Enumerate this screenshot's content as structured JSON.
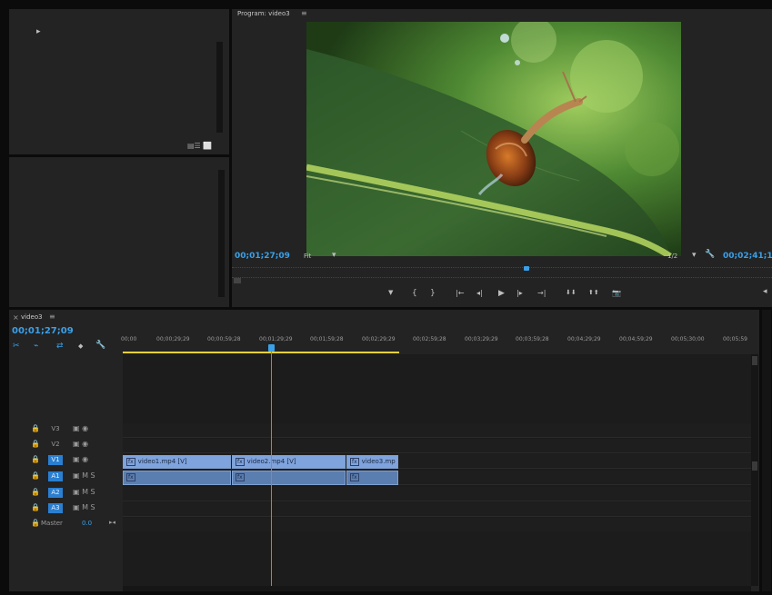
{
  "colors": {
    "accent": "#3aa0e8",
    "panel": "#232323",
    "video_clip": "#7fa3dc",
    "audio_clip": "#5b7eb0",
    "timebar": "#e5d03a"
  },
  "top_left_panel": {
    "arrow": "▸",
    "icons": "▤☰ ⬜"
  },
  "program_monitor": {
    "title": "Program: video3",
    "menu_icon": "≡",
    "timecode_current": "00;01;27;09",
    "fit_label": "Fit",
    "fit_dropdown_icon": "▾",
    "resolution": "1/2",
    "resolution_dropdown_icon": "▾",
    "wrench_icon": "🔧",
    "timecode_duration": "00;02;41;1",
    "controls": [
      "▼",
      "{",
      "}",
      "|←",
      "◂|",
      "▶",
      "|▸",
      "→|",
      "⬇⬇",
      "⬆⬆",
      "📷"
    ]
  },
  "timeline": {
    "tab_close": "×",
    "tab_name": "video3",
    "tab_menu": "≡",
    "timecode": "00;01;27;09",
    "tool_icons": [
      "✂",
      "⌁",
      "⇄",
      "◆",
      "🔧"
    ],
    "ruler": [
      "00;00",
      "00;00;29;29",
      "00;00;59;28",
      "00;01;29;29",
      "00;01;59;28",
      "00;02;29;29",
      "00;02;59;28",
      "00;03;29;29",
      "00;03;59;28",
      "00;04;29;29",
      "00;04;59;29",
      "00;05;30;00",
      "00;05;59"
    ],
    "tracks": [
      {
        "name": "V3",
        "lock": "🔒",
        "icons": "▣ ◉",
        "selected": false
      },
      {
        "name": "V2",
        "lock": "🔒",
        "icons": "▣ ◉",
        "selected": false
      },
      {
        "name": "V1",
        "lock": "🔒",
        "icons": "▣ ◉",
        "selected": true
      },
      {
        "name": "A1",
        "lock": "🔒",
        "icons": "▣ M S",
        "selected": true
      },
      {
        "name": "A2",
        "lock": "🔒",
        "icons": "▣ M S",
        "selected": true
      },
      {
        "name": "A3",
        "lock": "🔒",
        "icons": "▣ M S",
        "selected": true
      }
    ],
    "master": {
      "label": "Master",
      "value": "0.0",
      "end_icon": "▸◂"
    },
    "video_clips": [
      "video1.mp4 [V]",
      "video2.mp4 [V]",
      "video3.mp"
    ],
    "fx_badge": "fx",
    "audio_clip_icon": "fx"
  },
  "timeline_side_glyph": "◂"
}
